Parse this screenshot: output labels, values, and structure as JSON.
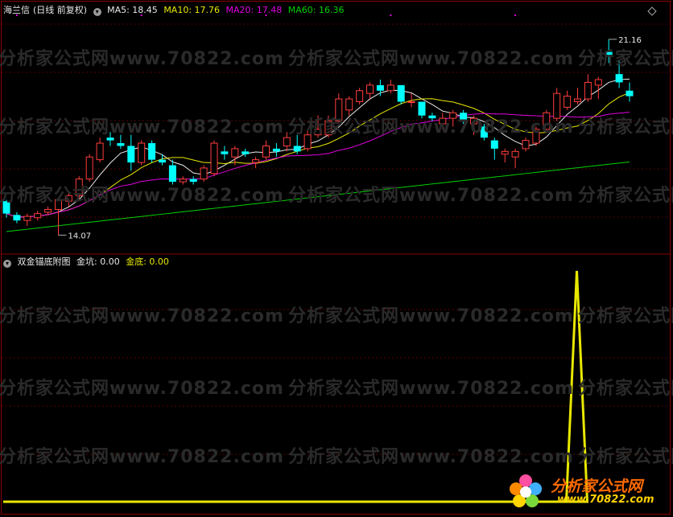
{
  "main_panel": {
    "stock_name": "海兰信",
    "period_label": "(日线 前复权)",
    "ma5": {
      "label": "MA5: 18.45",
      "color": "#e8e8e8"
    },
    "ma10": {
      "label": "MA10: 17.76",
      "color": "#e8e800"
    },
    "ma20": {
      "label": "MA20: 17.48",
      "color": "#e000e0"
    },
    "ma60": {
      "label": "MA60: 16.36",
      "color": "#00d000"
    },
    "high_marker": "21.16",
    "low_marker": "14.07"
  },
  "sub_panel": {
    "indicator_name": "双金锚底附图",
    "jinkeng": {
      "label": "金坑: 0.00",
      "color": "#e8e8e8"
    },
    "jindi": {
      "label": "金底: 0.00",
      "color": "#e8e800"
    }
  },
  "watermark": {
    "text": "分析家公式网www.70822.com"
  },
  "logo": {
    "name": "分析家公式网",
    "url": "www.70822.com"
  },
  "chart_data": [
    {
      "type": "candlestick",
      "title": "海兰信 (日线 前复权)",
      "ylim": [
        13.5,
        22
      ],
      "up_color": "#ff3c3c",
      "down_color": "#00ffff",
      "candles": [
        [
          15.3,
          15.35,
          14.7,
          14.85
        ],
        [
          14.8,
          14.9,
          14.5,
          14.6
        ],
        [
          14.6,
          14.85,
          14.4,
          14.75
        ],
        [
          14.7,
          14.95,
          14.6,
          14.85
        ],
        [
          14.9,
          15.1,
          14.8,
          15.0
        ],
        [
          15.0,
          15.4,
          14.07,
          15.35
        ],
        [
          15.3,
          15.6,
          15.1,
          15.5
        ],
        [
          15.5,
          16.2,
          15.4,
          16.1
        ],
        [
          16.1,
          17.0,
          16.0,
          16.9
        ],
        [
          16.8,
          17.6,
          16.7,
          17.4
        ],
        [
          17.6,
          17.8,
          17.3,
          17.5
        ],
        [
          17.4,
          17.7,
          17.2,
          17.3
        ],
        [
          17.3,
          17.7,
          16.4,
          16.7
        ],
        [
          16.7,
          17.5,
          16.6,
          17.4
        ],
        [
          17.4,
          17.5,
          16.7,
          16.8
        ],
        [
          16.8,
          17.0,
          16.6,
          16.7
        ],
        [
          16.6,
          16.8,
          15.9,
          16.0
        ],
        [
          16.0,
          16.2,
          15.9,
          16.1
        ],
        [
          16.1,
          16.2,
          15.9,
          16.0
        ],
        [
          16.1,
          16.6,
          16.0,
          16.5
        ],
        [
          16.3,
          17.5,
          16.2,
          17.4
        ],
        [
          17.1,
          17.3,
          16.8,
          17.0
        ],
        [
          16.9,
          17.3,
          16.6,
          17.2
        ],
        [
          17.1,
          17.2,
          16.9,
          17.0
        ],
        [
          16.7,
          16.9,
          16.5,
          16.8
        ],
        [
          16.9,
          17.5,
          16.8,
          17.3
        ],
        [
          17.2,
          17.4,
          16.9,
          17.1
        ],
        [
          17.3,
          17.8,
          17.1,
          17.6
        ],
        [
          17.3,
          17.7,
          17.0,
          17.1
        ],
        [
          17.2,
          17.9,
          17.1,
          17.7
        ],
        [
          17.7,
          18.4,
          17.6,
          17.9
        ],
        [
          17.7,
          18.4,
          17.6,
          18.2
        ],
        [
          18.2,
          19.2,
          18.1,
          19.0
        ],
        [
          18.6,
          19.1,
          18.4,
          19.0
        ],
        [
          18.9,
          19.4,
          18.8,
          19.3
        ],
        [
          19.2,
          19.6,
          19.0,
          19.5
        ],
        [
          19.5,
          19.7,
          19.1,
          19.3
        ],
        [
          19.3,
          19.7,
          19.2,
          19.5
        ],
        [
          19.5,
          19.5,
          18.8,
          18.9
        ],
        [
          18.9,
          19.2,
          18.7,
          18.9
        ],
        [
          18.9,
          18.9,
          18.3,
          18.4
        ],
        [
          18.4,
          18.5,
          18.2,
          18.3
        ],
        [
          18.1,
          18.5,
          17.9,
          18.3
        ],
        [
          18.3,
          18.6,
          18.0,
          18.5
        ],
        [
          18.5,
          18.6,
          18.1,
          18.2
        ],
        [
          18.1,
          18.4,
          17.7,
          18.3
        ],
        [
          18.0,
          18.1,
          17.5,
          17.6
        ],
        [
          17.5,
          17.6,
          16.8,
          17.2
        ],
        [
          17.0,
          17.2,
          16.7,
          17.1
        ],
        [
          16.9,
          17.2,
          16.5,
          17.1
        ],
        [
          17.2,
          17.6,
          17.1,
          17.5
        ],
        [
          17.4,
          18.0,
          17.3,
          17.9
        ],
        [
          17.9,
          18.6,
          17.8,
          18.5
        ],
        [
          18.3,
          19.4,
          18.2,
          19.2
        ],
        [
          18.7,
          19.3,
          18.6,
          19.1
        ],
        [
          18.9,
          19.4,
          18.8,
          19.0
        ],
        [
          19.0,
          19.9,
          18.9,
          19.6
        ],
        [
          19.5,
          19.8,
          19.0,
          19.7
        ],
        [
          20.7,
          21.16,
          20.3,
          20.6
        ],
        [
          19.9,
          20.4,
          19.4,
          19.6
        ],
        [
          19.3,
          19.6,
          18.9,
          19.1
        ]
      ],
      "ma_lines": [
        {
          "name": "MA5",
          "color": "#e8e8e8"
        },
        {
          "name": "MA10",
          "color": "#e8e800"
        },
        {
          "name": "MA20",
          "color": "#e000e0"
        },
        {
          "name": "MA60",
          "color": "#00d000"
        }
      ]
    },
    {
      "type": "line",
      "title": "双金锚底附图",
      "series": [
        {
          "name": "金坑",
          "color": "#e8e8e8",
          "values": []
        },
        {
          "name": "金底",
          "color": "#e8e800",
          "spike_index": 55,
          "spike_value": 1
        }
      ]
    }
  ]
}
